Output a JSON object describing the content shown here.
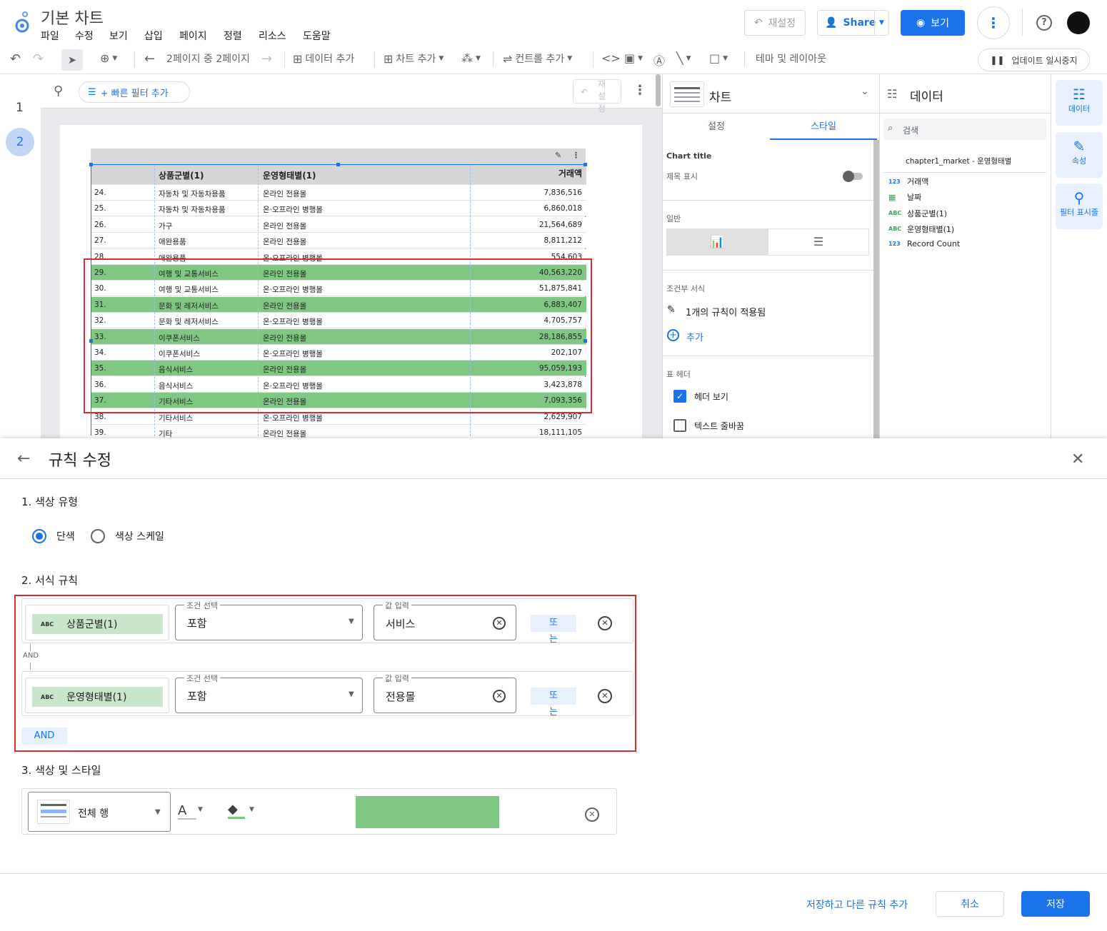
{
  "header": {
    "title": "기본 차트",
    "menus": [
      "파일",
      "수정",
      "보기",
      "삽입",
      "페이지",
      "정렬",
      "리소스",
      "도움말"
    ],
    "reset_label": "재설정",
    "share_label": "Share",
    "view_label": "보기"
  },
  "toolbar": {
    "page_indicator": "2페이지 중 2페이지",
    "add_data": "데이터 추가",
    "add_chart": "차트 추가",
    "add_control": "컨트롤 추가",
    "theme_layout": "테마 및 레이아웃",
    "pause_updates": "업데이트 일시중지"
  },
  "pagenav": {
    "pages": [
      "1",
      "2"
    ]
  },
  "canvas": {
    "quick_filter": "+ 빠른 필터 추가",
    "reset_vertical": "재설정",
    "table": {
      "headers": [
        "상품군별(1)",
        "운영형태별(1)",
        "거래액"
      ],
      "rows": [
        {
          "n": "24.",
          "cat": "자동차 및 자동차용품",
          "type": "온라인 전용몰",
          "amount": "7,836,516",
          "hl": false
        },
        {
          "n": "25.",
          "cat": "자동차 및 자동차용품",
          "type": "온·오프라인 병행몰",
          "amount": "6,860,018",
          "hl": false
        },
        {
          "n": "26.",
          "cat": "가구",
          "type": "온라인 전용몰",
          "amount": "21,564,689",
          "hl": false
        },
        {
          "n": "27.",
          "cat": "애완용품",
          "type": "온라인 전용몰",
          "amount": "8,811,212",
          "hl": false
        },
        {
          "n": "28.",
          "cat": "애완용품",
          "type": "온·오프라인 병행몰",
          "amount": "554,603",
          "hl": false
        },
        {
          "n": "29.",
          "cat": "여행 및 교통서비스",
          "type": "온라인 전용몰",
          "amount": "40,563,220",
          "hl": true
        },
        {
          "n": "30.",
          "cat": "여행 및 교통서비스",
          "type": "온·오프라인 병행몰",
          "amount": "51,875,841",
          "hl": false
        },
        {
          "n": "31.",
          "cat": "문화 및 레저서비스",
          "type": "온라인 전용몰",
          "amount": "6,883,407",
          "hl": true
        },
        {
          "n": "32.",
          "cat": "문화 및 레저서비스",
          "type": "온·오프라인 병행몰",
          "amount": "4,705,757",
          "hl": false
        },
        {
          "n": "33.",
          "cat": "이쿠폰서비스",
          "type": "온라인 전용몰",
          "amount": "28,186,855",
          "hl": true
        },
        {
          "n": "34.",
          "cat": "이쿠폰서비스",
          "type": "온·오프라인 병행몰",
          "amount": "202,107",
          "hl": false
        },
        {
          "n": "35.",
          "cat": "음식서비스",
          "type": "온라인 전용몰",
          "amount": "95,059,193",
          "hl": true
        },
        {
          "n": "36.",
          "cat": "음식서비스",
          "type": "온·오프라인 병행몰",
          "amount": "3,423,878",
          "hl": false
        },
        {
          "n": "37.",
          "cat": "기타서비스",
          "type": "온라인 전용몰",
          "amount": "7,093,356",
          "hl": true
        },
        {
          "n": "38.",
          "cat": "기타서비스",
          "type": "온·오프라인 병행몰",
          "amount": "2,629,907",
          "hl": false
        },
        {
          "n": "39.",
          "cat": "기타",
          "type": "온라인 전용몰",
          "amount": "18,111,105",
          "hl": false
        }
      ]
    }
  },
  "panel": {
    "title": "차트",
    "tabs": [
      "설정",
      "스타일"
    ],
    "chart_title_label": "Chart title",
    "show_title": "제목 표시",
    "general": "일반",
    "conditional": "조건부 서식",
    "rules_applied": "1개의 규칙이 적용됨",
    "add": "추가",
    "table_header": "표 헤더",
    "show_header": "헤더 보기",
    "wrap_text": "텍스트 줄바꿈"
  },
  "datapanel": {
    "title": "데이터",
    "search_placeholder": "검색",
    "source": "chapter1_market - 운영형태별",
    "fields": [
      {
        "type": "123",
        "name": "거래액"
      },
      {
        "type": "date",
        "name": "날짜"
      },
      {
        "type": "ABC",
        "name": "상품군별(1)"
      },
      {
        "type": "ABC",
        "name": "운영형태별(1)"
      },
      {
        "type": "123",
        "name": "Record Count"
      }
    ]
  },
  "rail": {
    "data": "데이터",
    "props": "속성",
    "filter": "필터 표시줄"
  },
  "dialog": {
    "title": "규칙 수정",
    "s1": "1. 색상 유형",
    "solid": "단색",
    "scale": "색상 스케일",
    "s2": "2. 서식 규칙",
    "cond_label": "조건 선택",
    "value_label": "값 입력",
    "rules": [
      {
        "field": "상품군별(1)",
        "cond": "포함",
        "value": "서비스",
        "or": "또는"
      },
      {
        "field": "운영형태별(1)",
        "cond": "포함",
        "value": "전용몰",
        "or": "또는"
      }
    ],
    "and_small": "AND",
    "and_btn": "AND",
    "s3": "3. 색상 및 스타일",
    "apply_to": "전체 행",
    "fill_color": "#81c784",
    "save_add": "저장하고 다른 규칙 추가",
    "cancel": "취소",
    "save": "저장"
  },
  "colors": {
    "accent": "#1a73e8",
    "highlight": "#81c784",
    "annotation": "#d32f2f"
  }
}
